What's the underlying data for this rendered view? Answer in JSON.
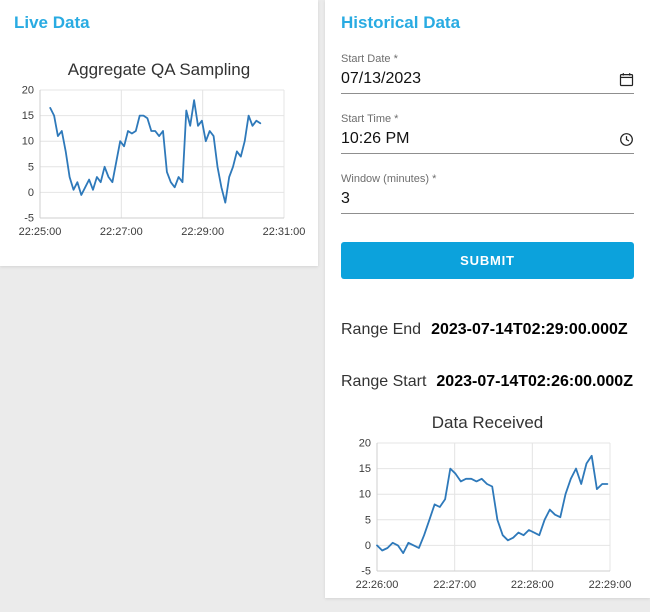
{
  "live_panel": {
    "title": "Live Data"
  },
  "historical_panel": {
    "title": "Historical Data",
    "form": {
      "start_date": {
        "label": "Start Date *",
        "value": "07/13/2023",
        "icon": "calendar-icon"
      },
      "start_time": {
        "label": "Start Time *",
        "value": "10:26 PM",
        "icon": "clock-icon"
      },
      "window": {
        "label": "Window (minutes) *",
        "value": "3"
      },
      "submit_label": "SUBMIT"
    },
    "range_end": {
      "label": "Range End",
      "value": "2023-07-14T02:29:00.000Z"
    },
    "range_start": {
      "label": "Range Start",
      "value": "2023-07-14T02:26:00.000Z"
    }
  },
  "colors": {
    "accent": "#29abe2",
    "button": "#0ca2dc",
    "line": "#2e79ba"
  },
  "chart_data": [
    {
      "type": "line",
      "title": "Aggregate QA Sampling",
      "xlabel": "",
      "ylabel": "",
      "ylim": [
        -5,
        20
      ],
      "yticks": [
        -5,
        0,
        5,
        10,
        15,
        20
      ],
      "grid": true,
      "legend": false,
      "x_axis_seconds": [
        0,
        360
      ],
      "xticks": [
        {
          "pos": 0,
          "label": "22:25:00"
        },
        {
          "pos": 120,
          "label": "22:27:00"
        },
        {
          "pos": 240,
          "label": "22:29:00"
        },
        {
          "pos": 360,
          "label": "22:31:00"
        }
      ],
      "data_x_seconds": [
        15,
        325
      ],
      "line_color": "#2e79ba",
      "values": [
        16.5,
        15,
        11,
        12,
        8,
        3,
        0.5,
        2,
        -0.5,
        1,
        2.5,
        0.5,
        3,
        2,
        5,
        3,
        2,
        6,
        10,
        9,
        12,
        11.5,
        12,
        15,
        15,
        14.5,
        12,
        12,
        11,
        12,
        4,
        2,
        1,
        3,
        2,
        16,
        13,
        18,
        13,
        14,
        10,
        12,
        11,
        5,
        1,
        -2,
        3,
        5,
        8,
        7,
        10,
        15,
        13,
        14,
        13.5
      ]
    },
    {
      "type": "line",
      "title": "Data Received",
      "xlabel": "",
      "ylabel": "",
      "ylim": [
        -5,
        20
      ],
      "yticks": [
        -5,
        0,
        5,
        10,
        15,
        20
      ],
      "grid": true,
      "legend": false,
      "x_axis_seconds": [
        0,
        180
      ],
      "xticks": [
        {
          "pos": 0,
          "label": "22:26:00"
        },
        {
          "pos": 60,
          "label": "22:27:00"
        },
        {
          "pos": 120,
          "label": "22:28:00"
        },
        {
          "pos": 180,
          "label": "22:29:00"
        }
      ],
      "data_x_seconds": [
        0,
        178
      ],
      "line_color": "#2e79ba",
      "values": [
        0,
        -1,
        -0.5,
        0.5,
        0,
        -1.5,
        0.5,
        0,
        -0.5,
        2,
        5,
        8,
        7.5,
        9,
        15,
        14,
        12.5,
        13,
        13,
        12.5,
        13,
        12,
        11.5,
        5,
        2,
        1,
        1.5,
        2.5,
        2,
        3,
        2.5,
        2,
        5,
        7,
        6,
        5.5,
        10,
        13,
        15,
        12,
        16,
        17.5,
        11,
        12,
        12
      ]
    }
  ]
}
